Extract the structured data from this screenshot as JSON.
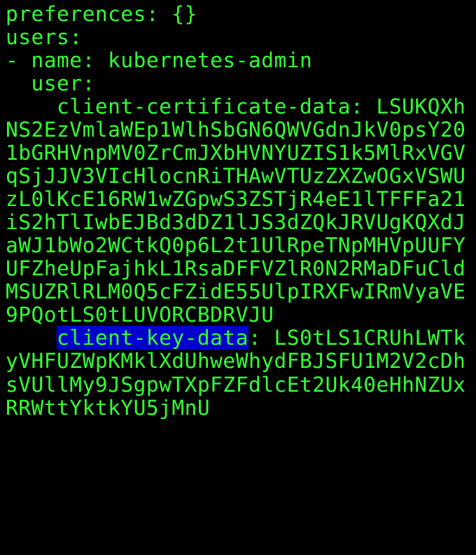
{
  "terminal": {
    "line1": "preferences: {}",
    "line2": "users:",
    "line3": "- name: kubernetes-admin",
    "line4": "  user:",
    "line5": "    client-certificate-data: LSUKQXhNS2EzVmlaWEp1WlhSbGN6QWVGdnJkV0psY201bGRHVnpMV0ZrCmJXbHVNYUZIS1k5MlRxVGVqSjJJV3VIcHlocnRiTHAwVTUzZXZwOGxVSWUzL0lKcE16RW1wZGpwS3ZSTjR4eE1lTFFFa21iS2hTlIwbEJBd3dDZ1lJS3dZQkJRVUgKQXdJaWJ1bWo2WCtkQ0p6L2t1UlRpeTNpMHVpUUFYUFZheUpFajhkL1RsaDFFVZlR0N2RMaDFuCldMSUZRlRLM0Q5cFZidE55UlpIRXFwIRmVyaVE9PQotLS0tLUVORCBDRVJU",
    "line6_prefix": "    ",
    "line6_highlighted": "client-key-data",
    "line6_suffix": ": LS0tLS1CRUhLWTkyVHFUZWpKMklXdUhweWhydFBJSFU1M2V2cDhsVUllMy9JSgpwTXpFZFdlcEt2Uk40eHhNZUxRRWttYktkYU5jMnU"
  }
}
